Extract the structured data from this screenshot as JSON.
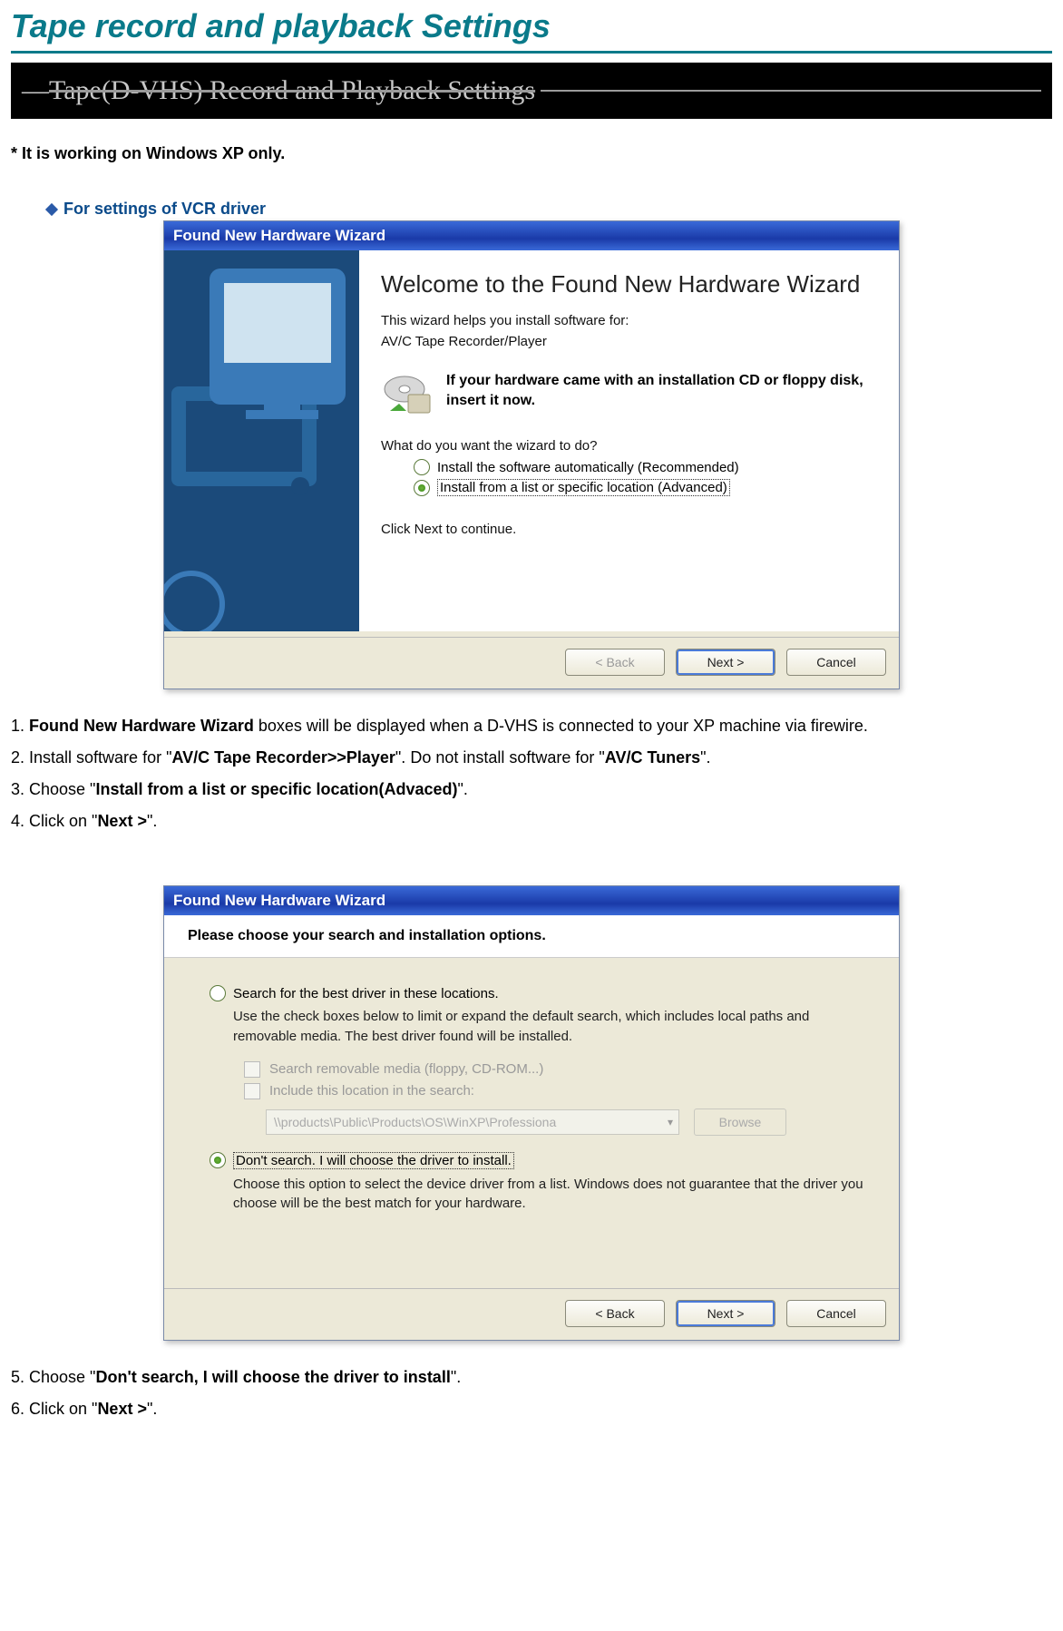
{
  "page": {
    "main_title": "Tape record and playback Settings",
    "band_text": "Tape(D-VHS) Record and Playback Settings",
    "xp_note": "* It is working on Windows XP only.",
    "section_title": "For settings of VCR driver"
  },
  "wizard1": {
    "titlebar": "Found New Hardware Wizard",
    "heading": "Welcome to the Found New Hardware Wizard",
    "helps": "This wizard helps you install software for:",
    "device": "AV/C Tape Recorder/Player",
    "cd_text": "If your hardware came with an installation CD or floppy disk, insert it now.",
    "question": "What do you want the wizard to do?",
    "opt_auto": "Install the software automatically (Recommended)",
    "opt_list": "Install from a list or specific location (Advanced)",
    "click_next": "Click Next to continue.",
    "btn_back": "< Back",
    "btn_next": "Next >",
    "btn_cancel": "Cancel"
  },
  "steps1": {
    "s1a": "1. ",
    "s1b": "Found New Hardware Wizard",
    "s1c": " boxes will be displayed when a D-VHS is connected to your XP machine via firewire.",
    "s2a": "2. Install software for \"",
    "s2b": "AV/C Tape Recorder>>Player",
    "s2c": "\". Do not install software for \"",
    "s2d": "AV/C Tuners",
    "s2e": "\".",
    "s3a": "3. Choose \"",
    "s3b": "Install from a list or specific location(Advaced)",
    "s3c": "\".",
    "s4a": "4. Click on \"",
    "s4b": "Next >",
    "s4c": "\"."
  },
  "wizard2": {
    "titlebar": "Found New Hardware Wizard",
    "heading": "Please choose your search and installation options.",
    "opt_search": "Search for the best driver in these locations.",
    "search_desc": "Use the check boxes below to limit or expand the default search, which includes local paths and removable media. The best driver found will be installed.",
    "chk_media": "Search removable media (floppy, CD-ROM...)",
    "chk_include": "Include this location in the search:",
    "path_value": "\\\\products\\Public\\Products\\OS\\WinXP\\Professiona",
    "browse": "Browse",
    "opt_dont": "Don't search. I will choose the driver to install.",
    "dont_desc": "Choose this option to select the device driver from a list.  Windows does not guarantee that the driver you choose will be the best match for your hardware.",
    "btn_back": "< Back",
    "btn_next": "Next >",
    "btn_cancel": "Cancel"
  },
  "steps2": {
    "s5a": "5. Choose \"",
    "s5b": "Don't search, I will choose the driver to install",
    "s5c": "\".",
    "s6a": "6. Click on \"",
    "s6b": "Next >",
    "s6c": "\"."
  }
}
